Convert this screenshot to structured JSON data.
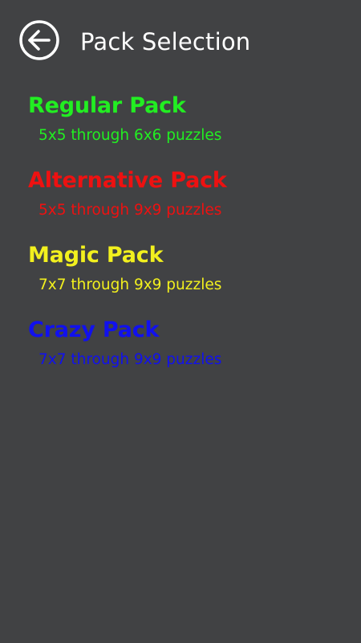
{
  "header": {
    "title": "Pack Selection",
    "back_icon": "arrow-left-circle-icon"
  },
  "packs": [
    {
      "title": "Regular Pack",
      "description": "5x5 through 6x6 puzzles",
      "color": "#22ee22"
    },
    {
      "title": "Alternative Pack",
      "description": "5x5 through 9x9 puzzles",
      "color": "#ee1111"
    },
    {
      "title": "Magic Pack",
      "description": "7x7 through 9x9 puzzles",
      "color": "#f2f01e"
    },
    {
      "title": "Crazy Pack",
      "description": "7x7 through 9x9 puzzles",
      "color": "#1111ee"
    }
  ],
  "colors": {
    "background": "#414244",
    "header_text": "#ffffff"
  }
}
